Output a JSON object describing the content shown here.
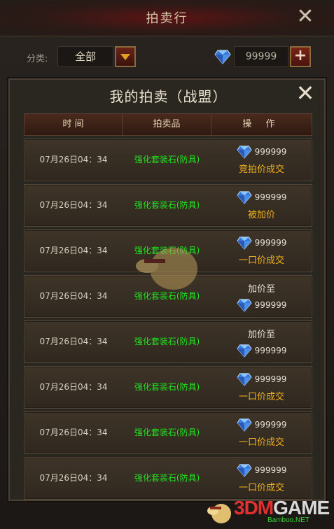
{
  "window": {
    "title": "拍卖行",
    "close_icon": "close-icon"
  },
  "filter": {
    "label": "分类:",
    "selected": "全部",
    "dropdown_icon": "chevron-down-icon"
  },
  "currency": {
    "icon": "diamond-icon",
    "amount": "99999",
    "add_label": "+"
  },
  "panel": {
    "title": "我的拍卖（战盟）",
    "columns": [
      "时 间",
      "拍卖品",
      "操 作"
    ]
  },
  "rows": [
    {
      "time": "07月26日04：34",
      "item": "强化套装石(防具)",
      "amount": "999999",
      "status": "竞拍价成交",
      "order": "amount-first"
    },
    {
      "time": "07月26日04：34",
      "item": "强化套装石(防具)",
      "amount": "999999",
      "status": "被加价",
      "order": "amount-first"
    },
    {
      "time": "07月26日04：34",
      "item": "强化套装石(防具)",
      "amount": "999999",
      "status": "一口价成交",
      "order": "amount-first"
    },
    {
      "time": "07月26日04：34",
      "item": "强化套装石(防具)",
      "amount": "999999",
      "status": "加价至",
      "order": "status-first"
    },
    {
      "time": "07月26日04：34",
      "item": "强化套装石(防具)",
      "amount": "999999",
      "status": "加价至",
      "order": "status-first"
    },
    {
      "time": "07月26日04：34",
      "item": "强化套装石(防具)",
      "amount": "999999",
      "status": "一口价成交",
      "order": "amount-first"
    },
    {
      "time": "07月26日04：34",
      "item": "强化套装石(防具)",
      "amount": "999999",
      "status": "一口价成交",
      "order": "amount-first"
    },
    {
      "time": "07月26日04：34",
      "item": "强化套装石(防具)",
      "amount": "999999",
      "status": "一口价成交",
      "order": "amount-first"
    }
  ],
  "watermark": {
    "brand_a": "3DM",
    "brand_b": "GAME",
    "sub": "Bamboo.NET"
  },
  "colors": {
    "item_green": "#22e022",
    "status_gold": "#f0b020",
    "gem_blue": "#4aa8ff"
  }
}
